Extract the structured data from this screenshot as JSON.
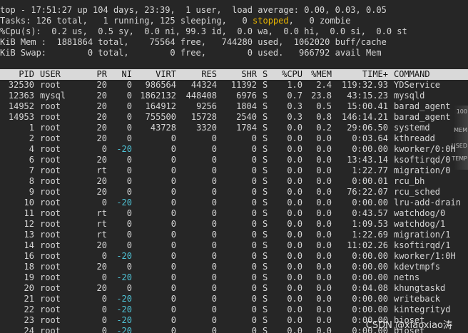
{
  "summary": {
    "line1": "top - 17:51:27 up 104 days, 23:39,  1 user,  load average: 0.00, 0.03, 0.05",
    "line2_pre": "Tasks: 126 total,   1 running, 125 sleeping,   0 ",
    "line2_stopped": "stopped",
    "line2_post": ",   0 zombie",
    "line3": "%Cpu(s):  0.2 us,  0.5 sy,  0.0 ni, 99.3 id,  0.0 wa,  0.0 hi,  0.0 si,  0.0 st",
    "line4": "KiB Mem :  1881864 total,    75564 free,   744280 used,  1062020 buff/cache",
    "line5": "KiB Swap:        0 total,        0 free,        0 used.   966792 avail Mem"
  },
  "columns": [
    "PID",
    "USER",
    "PR",
    "NI",
    "VIRT",
    "RES",
    "SHR",
    "S",
    "%CPU",
    "%MEM",
    "TIME+",
    "COMMAND"
  ],
  "processes": [
    {
      "pid": "32530",
      "user": "root",
      "pr": "20",
      "ni": "0",
      "virt": "986564",
      "res": "44324",
      "shr": "11392",
      "s": "S",
      "cpu": "1.0",
      "mem": "2.4",
      "time": "119:32.93",
      "command": "YDService"
    },
    {
      "pid": "12363",
      "user": "mysql",
      "pr": "20",
      "ni": "0",
      "virt": "1862132",
      "res": "448408",
      "shr": "6976",
      "s": "S",
      "cpu": "0.7",
      "mem": "23.8",
      "time": "43:15.23",
      "command": "mysqld"
    },
    {
      "pid": "14952",
      "user": "root",
      "pr": "20",
      "ni": "0",
      "virt": "164912",
      "res": "9256",
      "shr": "1804",
      "s": "S",
      "cpu": "0.3",
      "mem": "0.5",
      "time": "15:00.41",
      "command": "barad_agent"
    },
    {
      "pid": "14953",
      "user": "root",
      "pr": "20",
      "ni": "0",
      "virt": "755500",
      "res": "15728",
      "shr": "2540",
      "s": "S",
      "cpu": "0.3",
      "mem": "0.8",
      "time": "146:14.21",
      "command": "barad_agent"
    },
    {
      "pid": "1",
      "user": "root",
      "pr": "20",
      "ni": "0",
      "virt": "43728",
      "res": "3320",
      "shr": "1784",
      "s": "S",
      "cpu": "0.0",
      "mem": "0.2",
      "time": "29:06.50",
      "command": "systemd"
    },
    {
      "pid": "2",
      "user": "root",
      "pr": "20",
      "ni": "0",
      "virt": "0",
      "res": "0",
      "shr": "0",
      "s": "S",
      "cpu": "0.0",
      "mem": "0.0",
      "time": "0:03.64",
      "command": "kthreadd"
    },
    {
      "pid": "4",
      "user": "root",
      "pr": "0",
      "ni": "-20",
      "virt": "0",
      "res": "0",
      "shr": "0",
      "s": "S",
      "cpu": "0.0",
      "mem": "0.0",
      "time": "0:00.00",
      "command": "kworker/0:0H"
    },
    {
      "pid": "6",
      "user": "root",
      "pr": "20",
      "ni": "0",
      "virt": "0",
      "res": "0",
      "shr": "0",
      "s": "S",
      "cpu": "0.0",
      "mem": "0.0",
      "time": "13:43.14",
      "command": "ksoftirqd/0"
    },
    {
      "pid": "7",
      "user": "root",
      "pr": "rt",
      "ni": "0",
      "virt": "0",
      "res": "0",
      "shr": "0",
      "s": "S",
      "cpu": "0.0",
      "mem": "0.0",
      "time": "1:22.77",
      "command": "migration/0"
    },
    {
      "pid": "8",
      "user": "root",
      "pr": "20",
      "ni": "0",
      "virt": "0",
      "res": "0",
      "shr": "0",
      "s": "S",
      "cpu": "0.0",
      "mem": "0.0",
      "time": "0:00.01",
      "command": "rcu_bh"
    },
    {
      "pid": "9",
      "user": "root",
      "pr": "20",
      "ni": "0",
      "virt": "0",
      "res": "0",
      "shr": "0",
      "s": "S",
      "cpu": "0.0",
      "mem": "0.0",
      "time": "76:22.07",
      "command": "rcu_sched"
    },
    {
      "pid": "10",
      "user": "root",
      "pr": "0",
      "ni": "-20",
      "virt": "0",
      "res": "0",
      "shr": "0",
      "s": "S",
      "cpu": "0.0",
      "mem": "0.0",
      "time": "0:00.00",
      "command": "lru-add-drain"
    },
    {
      "pid": "11",
      "user": "root",
      "pr": "rt",
      "ni": "0",
      "virt": "0",
      "res": "0",
      "shr": "0",
      "s": "S",
      "cpu": "0.0",
      "mem": "0.0",
      "time": "0:43.57",
      "command": "watchdog/0"
    },
    {
      "pid": "12",
      "user": "root",
      "pr": "rt",
      "ni": "0",
      "virt": "0",
      "res": "0",
      "shr": "0",
      "s": "S",
      "cpu": "0.0",
      "mem": "0.0",
      "time": "1:09.53",
      "command": "watchdog/1"
    },
    {
      "pid": "13",
      "user": "root",
      "pr": "rt",
      "ni": "0",
      "virt": "0",
      "res": "0",
      "shr": "0",
      "s": "S",
      "cpu": "0.0",
      "mem": "0.0",
      "time": "1:22.69",
      "command": "migration/1"
    },
    {
      "pid": "14",
      "user": "root",
      "pr": "20",
      "ni": "0",
      "virt": "0",
      "res": "0",
      "shr": "0",
      "s": "S",
      "cpu": "0.0",
      "mem": "0.0",
      "time": "11:02.26",
      "command": "ksoftirqd/1"
    },
    {
      "pid": "16",
      "user": "root",
      "pr": "0",
      "ni": "-20",
      "virt": "0",
      "res": "0",
      "shr": "0",
      "s": "S",
      "cpu": "0.0",
      "mem": "0.0",
      "time": "0:00.00",
      "command": "kworker/1:0H"
    },
    {
      "pid": "18",
      "user": "root",
      "pr": "20",
      "ni": "0",
      "virt": "0",
      "res": "0",
      "shr": "0",
      "s": "S",
      "cpu": "0.0",
      "mem": "0.0",
      "time": "0:00.00",
      "command": "kdevtmpfs"
    },
    {
      "pid": "19",
      "user": "root",
      "pr": "0",
      "ni": "-20",
      "virt": "0",
      "res": "0",
      "shr": "0",
      "s": "S",
      "cpu": "0.0",
      "mem": "0.0",
      "time": "0:00.00",
      "command": "netns"
    },
    {
      "pid": "20",
      "user": "root",
      "pr": "20",
      "ni": "0",
      "virt": "0",
      "res": "0",
      "shr": "0",
      "s": "S",
      "cpu": "0.0",
      "mem": "0.0",
      "time": "0:04.08",
      "command": "khungtaskd"
    },
    {
      "pid": "21",
      "user": "root",
      "pr": "0",
      "ni": "-20",
      "virt": "0",
      "res": "0",
      "shr": "0",
      "s": "S",
      "cpu": "0.0",
      "mem": "0.0",
      "time": "0:00.00",
      "command": "writeback"
    },
    {
      "pid": "22",
      "user": "root",
      "pr": "0",
      "ni": "-20",
      "virt": "0",
      "res": "0",
      "shr": "0",
      "s": "S",
      "cpu": "0.0",
      "mem": "0.0",
      "time": "0:00.00",
      "command": "kintegrityd"
    },
    {
      "pid": "23",
      "user": "root",
      "pr": "0",
      "ni": "-20",
      "virt": "0",
      "res": "0",
      "shr": "0",
      "s": "S",
      "cpu": "0.0",
      "mem": "0.0",
      "time": "0:00.00",
      "command": "bioset"
    },
    {
      "pid": "24",
      "user": "root",
      "pr": "0",
      "ni": "-20",
      "virt": "0",
      "res": "0",
      "shr": "0",
      "s": "S",
      "cpu": "0.0",
      "mem": "0.0",
      "time": "0:00.00",
      "command": "bioset"
    }
  ],
  "watermark": "CSDN @xiaoxiao涛",
  "colors": {
    "background": "#262626",
    "text": "#d6d6d6",
    "highlight_stopped": "#e7b400",
    "negative_nice": "#4fc3d6",
    "header_background": "#d9d9d9"
  }
}
